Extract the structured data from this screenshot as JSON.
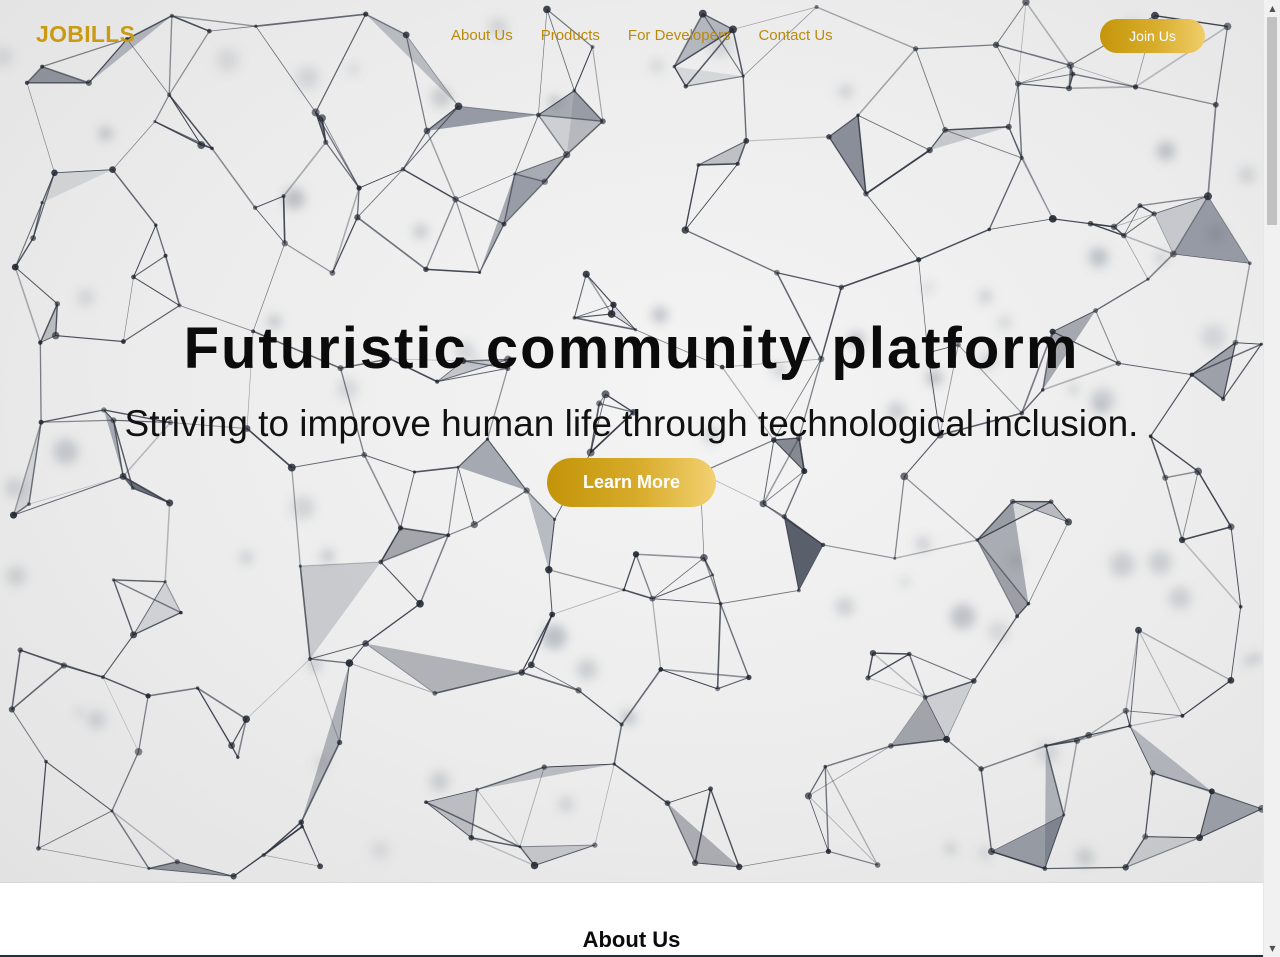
{
  "header": {
    "brand": "JOBILLS",
    "nav": [
      "About Us",
      "Products",
      "For Developers",
      "Contact Us"
    ],
    "cta": "Join Us"
  },
  "hero": {
    "title": "Futuristic community platform",
    "subtitle": "Striving to improve human life through technological inclusion.",
    "cta": "Learn More",
    "background": "network-graph-image"
  },
  "about": {
    "heading": "About Us"
  },
  "colors": {
    "accent": "#c99a12",
    "accent_light": "#f0cd6a",
    "text_dark": "#0b0b0b",
    "hero_bg": "#ececec"
  },
  "icons": {
    "scroll_up": "triangle-up-icon",
    "scroll_down": "triangle-down-icon"
  }
}
